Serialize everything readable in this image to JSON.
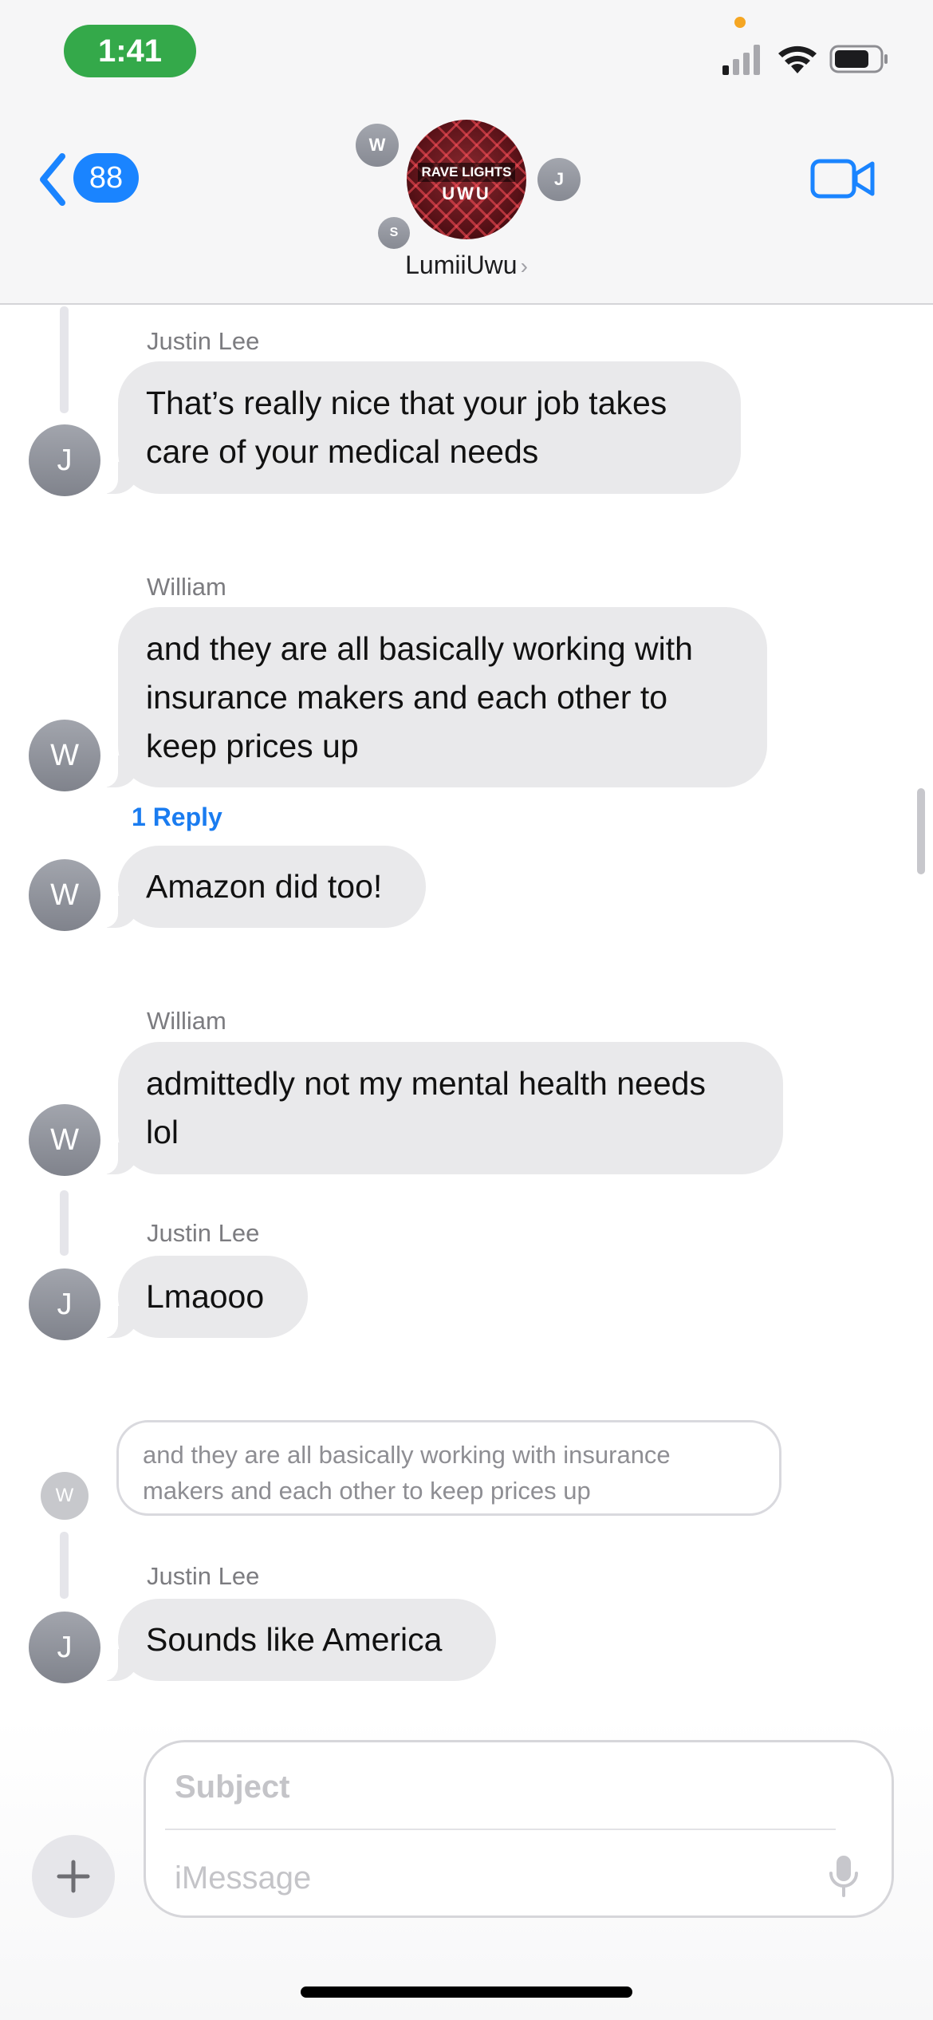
{
  "status_bar": {
    "time": "1:41"
  },
  "header": {
    "back_count": "88",
    "group_name": "LumiiUwu",
    "group_chevron": "›",
    "group_avatar_text_top": "RAVE LIGHTS",
    "group_avatar_text_bottom": "UWU",
    "member_initials": [
      "W",
      "J",
      "S"
    ]
  },
  "messages": [
    {
      "sender": "Justin Lee",
      "initial": "J",
      "lines": [
        "That’s really nice that your job takes",
        "care of your medical needs"
      ]
    },
    {
      "sender": "William",
      "initial": "W",
      "lines": [
        "and they are all basically working with",
        "insurance makers and each other to",
        "keep prices up"
      ],
      "reply_label": "1 Reply"
    },
    {
      "sender": "",
      "initial": "W",
      "lines": [
        "Amazon did too!"
      ]
    },
    {
      "sender": "William",
      "initial": "W",
      "lines": [
        "admittedly not my mental health needs",
        "lol"
      ]
    },
    {
      "sender": "Justin Lee",
      "initial": "J",
      "lines": [
        "Lmaooo"
      ]
    },
    {
      "sender": "Justin Lee",
      "initial": "J",
      "lines": [
        "Sounds like America"
      ]
    }
  ],
  "quoted_reply": {
    "initial": "W",
    "lines": [
      "and they are all basically working with insurance",
      "makers and each other to keep prices up"
    ]
  },
  "composer": {
    "subject_placeholder": "Subject",
    "message_placeholder": "iMessage"
  },
  "colors": {
    "accent": "#1a84ff",
    "time_pill": "#34a94a",
    "bubble": "#e9e9eb"
  }
}
